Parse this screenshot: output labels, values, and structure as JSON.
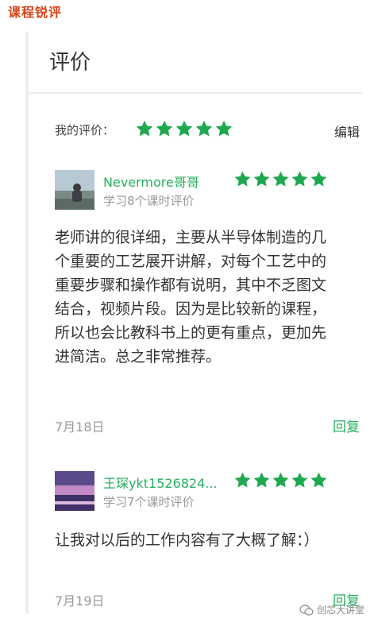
{
  "header": {
    "title": "课程锐评"
  },
  "panel": {
    "title": "评价"
  },
  "my_rating": {
    "label": "我的评价：",
    "stars": 5,
    "edit_label": "编辑"
  },
  "reviews": [
    {
      "name": "Nevermore哥哥",
      "meta": "学习8个课时评价",
      "stars": 5,
      "text": "老师讲的很详细，主要从半导体制造的几个重要的工艺展开讲解，对每个工艺中的重要步骤和操作都有说明，其中不乏图文结合，视频片段。因为是比较新的课程，所以也会比教科书上的更有重点，更加先进简洁。总之非常推荐。",
      "date": "7月18日",
      "reply_label": "回复"
    },
    {
      "name": "王琛ykt1526824...",
      "meta": "学习7个课时评价",
      "stars": 5,
      "text": "让我对以后的工作内容有了大概了解：）",
      "date": "7月19日",
      "reply_label": "回复"
    }
  ],
  "watermark": {
    "text": "创芯大讲堂"
  },
  "colors": {
    "accent_green": "#27ae60",
    "header_red": "#d9431a",
    "star_green": "#1fa84f"
  }
}
